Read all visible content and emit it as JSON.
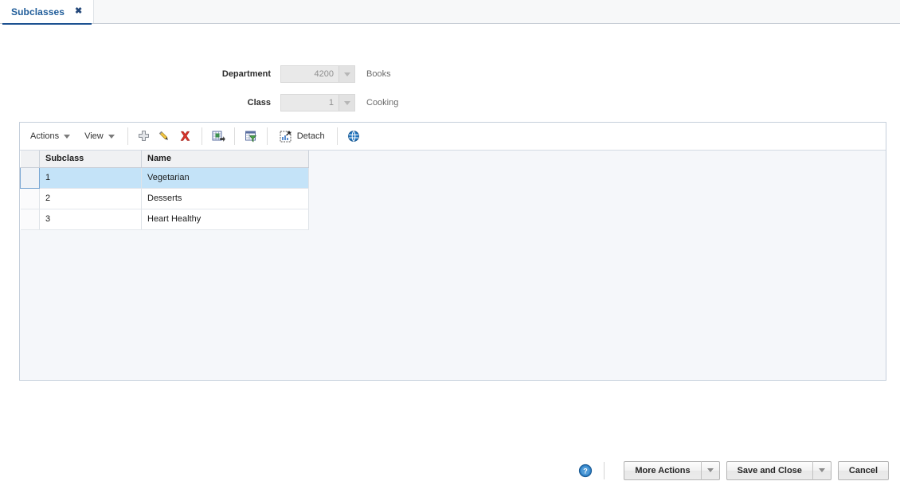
{
  "tabs": [
    {
      "label": "Subclasses",
      "close_label": "✖",
      "active": true
    }
  ],
  "form": {
    "department": {
      "label": "Department",
      "value": "4200",
      "description": "Books",
      "disabled": true
    },
    "class": {
      "label": "Class",
      "value": "1",
      "description": "Cooking",
      "disabled": true
    }
  },
  "toolbar": {
    "actions_label": "Actions",
    "view_label": "View",
    "detach_label": "Detach",
    "icons": [
      "add-icon",
      "edit-icon",
      "delete-icon",
      "export-to-excel-icon",
      "query-by-example-icon",
      "detach-icon",
      "globe-icon"
    ]
  },
  "table": {
    "columns": [
      "Subclass",
      "Name"
    ],
    "rows": [
      {
        "subclass": "1",
        "name": "Vegetarian",
        "selected": true
      },
      {
        "subclass": "2",
        "name": "Desserts",
        "selected": false
      },
      {
        "subclass": "3",
        "name": "Heart Healthy",
        "selected": false
      }
    ]
  },
  "footer": {
    "help_label": "?",
    "more_actions_label": "More Actions",
    "save_and_close_label": "Save and Close",
    "cancel_label": "Cancel"
  },
  "colors": {
    "tab_text": "#1f5c99",
    "tab_underline": "#1c5191",
    "panel_bg": "#f5f7fa",
    "panel_border": "#c5cfdb",
    "row_selected": "#c4e3f8",
    "grid_header_bg": "#f0f1f3",
    "delete_red": "#d9342b",
    "globe_blue": "#1e73be",
    "help_blue": "#2a7bc0"
  }
}
